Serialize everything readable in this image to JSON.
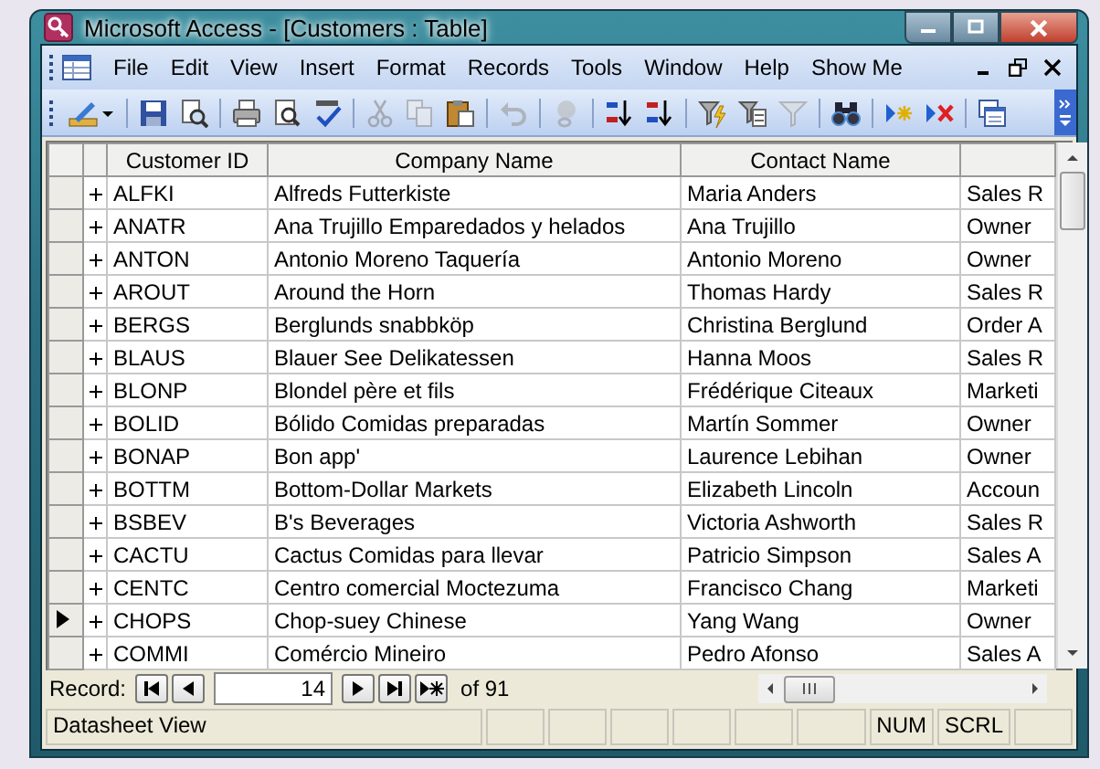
{
  "window": {
    "title": "Microsoft Access - [Customers : Table]"
  },
  "menu": [
    {
      "label": "File"
    },
    {
      "label": "Edit"
    },
    {
      "label": "View"
    },
    {
      "label": "Insert"
    },
    {
      "label": "Format"
    },
    {
      "label": "Records"
    },
    {
      "label": "Tools"
    },
    {
      "label": "Window"
    },
    {
      "label": "Help"
    },
    {
      "label": "Show Me"
    }
  ],
  "toolbar": [
    {
      "kind": "design",
      "disabled": false
    },
    {
      "kind": "sep"
    },
    {
      "kind": "save",
      "disabled": false
    },
    {
      "kind": "search",
      "disabled": false
    },
    {
      "kind": "sep"
    },
    {
      "kind": "print",
      "disabled": false
    },
    {
      "kind": "preview",
      "disabled": false
    },
    {
      "kind": "spell",
      "disabled": false
    },
    {
      "kind": "sep"
    },
    {
      "kind": "cut",
      "disabled": true
    },
    {
      "kind": "copy",
      "disabled": true
    },
    {
      "kind": "paste",
      "disabled": false
    },
    {
      "kind": "sep"
    },
    {
      "kind": "undo",
      "disabled": true
    },
    {
      "kind": "sep"
    },
    {
      "kind": "link",
      "disabled": true
    },
    {
      "kind": "sep"
    },
    {
      "kind": "sortup",
      "disabled": false
    },
    {
      "kind": "sortdown",
      "disabled": false
    },
    {
      "kind": "sep"
    },
    {
      "kind": "filter",
      "disabled": false
    },
    {
      "kind": "filterform",
      "disabled": false
    },
    {
      "kind": "applyfilter",
      "disabled": true
    },
    {
      "kind": "sep"
    },
    {
      "kind": "find",
      "disabled": false
    },
    {
      "kind": "sep"
    },
    {
      "kind": "newrecord",
      "disabled": false
    },
    {
      "kind": "deleterecord",
      "disabled": false
    },
    {
      "kind": "sep"
    },
    {
      "kind": "dbwindow",
      "disabled": false
    }
  ],
  "table": {
    "columns": [
      "Customer ID",
      "Company Name",
      "Contact Name"
    ],
    "rows": [
      {
        "id": "ALFKI",
        "company": "Alfreds Futterkiste",
        "contact": "Maria Anders",
        "column_4": "Sales R",
        "selected": false
      },
      {
        "id": "ANATR",
        "company": "Ana Trujillo Emparedados y helados",
        "contact": "Ana Trujillo",
        "column_4": "Owner",
        "selected": false
      },
      {
        "id": "ANTON",
        "company": "Antonio Moreno Taquería",
        "contact": "Antonio Moreno",
        "column_4": "Owner",
        "selected": false
      },
      {
        "id": "AROUT",
        "company": "Around the Horn",
        "contact": "Thomas Hardy",
        "column_4": "Sales R",
        "selected": false
      },
      {
        "id": "BERGS",
        "company": "Berglunds snabbköp",
        "contact": "Christina Berglund",
        "column_4": "Order A",
        "selected": false
      },
      {
        "id": "BLAUS",
        "company": "Blauer See Delikatessen",
        "contact": "Hanna Moos",
        "column_4": "Sales R",
        "selected": false
      },
      {
        "id": "BLONP",
        "company": "Blondel père et fils",
        "contact": "Frédérique Citeaux",
        "column_4": "Marketi",
        "selected": false
      },
      {
        "id": "BOLID",
        "company": "Bólido Comidas preparadas",
        "contact": "Martín Sommer",
        "column_4": "Owner",
        "selected": false
      },
      {
        "id": "BONAP",
        "company": "Bon app'",
        "contact": "Laurence Lebihan",
        "column_4": "Owner",
        "selected": false
      },
      {
        "id": "BOTTM",
        "company": "Bottom-Dollar Markets",
        "contact": "Elizabeth Lincoln",
        "column_4": "Accoun",
        "selected": false
      },
      {
        "id": "BSBEV",
        "company": "B's Beverages",
        "contact": "Victoria Ashworth",
        "column_4": "Sales R",
        "selected": false
      },
      {
        "id": "CACTU",
        "company": "Cactus Comidas para llevar",
        "contact": "Patricio Simpson",
        "column_4": "Sales A",
        "selected": false
      },
      {
        "id": "CENTC",
        "company": "Centro comercial Moctezuma",
        "contact": "Francisco Chang",
        "column_4": "Marketi",
        "selected": false
      },
      {
        "id": "CHOPS",
        "company": "Chop-suey Chinese",
        "contact": "Yang Wang",
        "column_4": "Owner",
        "selected": true
      },
      {
        "id": "COMMI",
        "company": "Comércio Mineiro",
        "contact": "Pedro Afonso",
        "column_4": "Sales A",
        "selected": false
      }
    ]
  },
  "navigator": {
    "label": "Record:",
    "current": "14",
    "total": "of 91"
  },
  "status_bar": {
    "text": "Datasheet View",
    "indicators": [
      "NUM",
      "SCRL"
    ]
  }
}
